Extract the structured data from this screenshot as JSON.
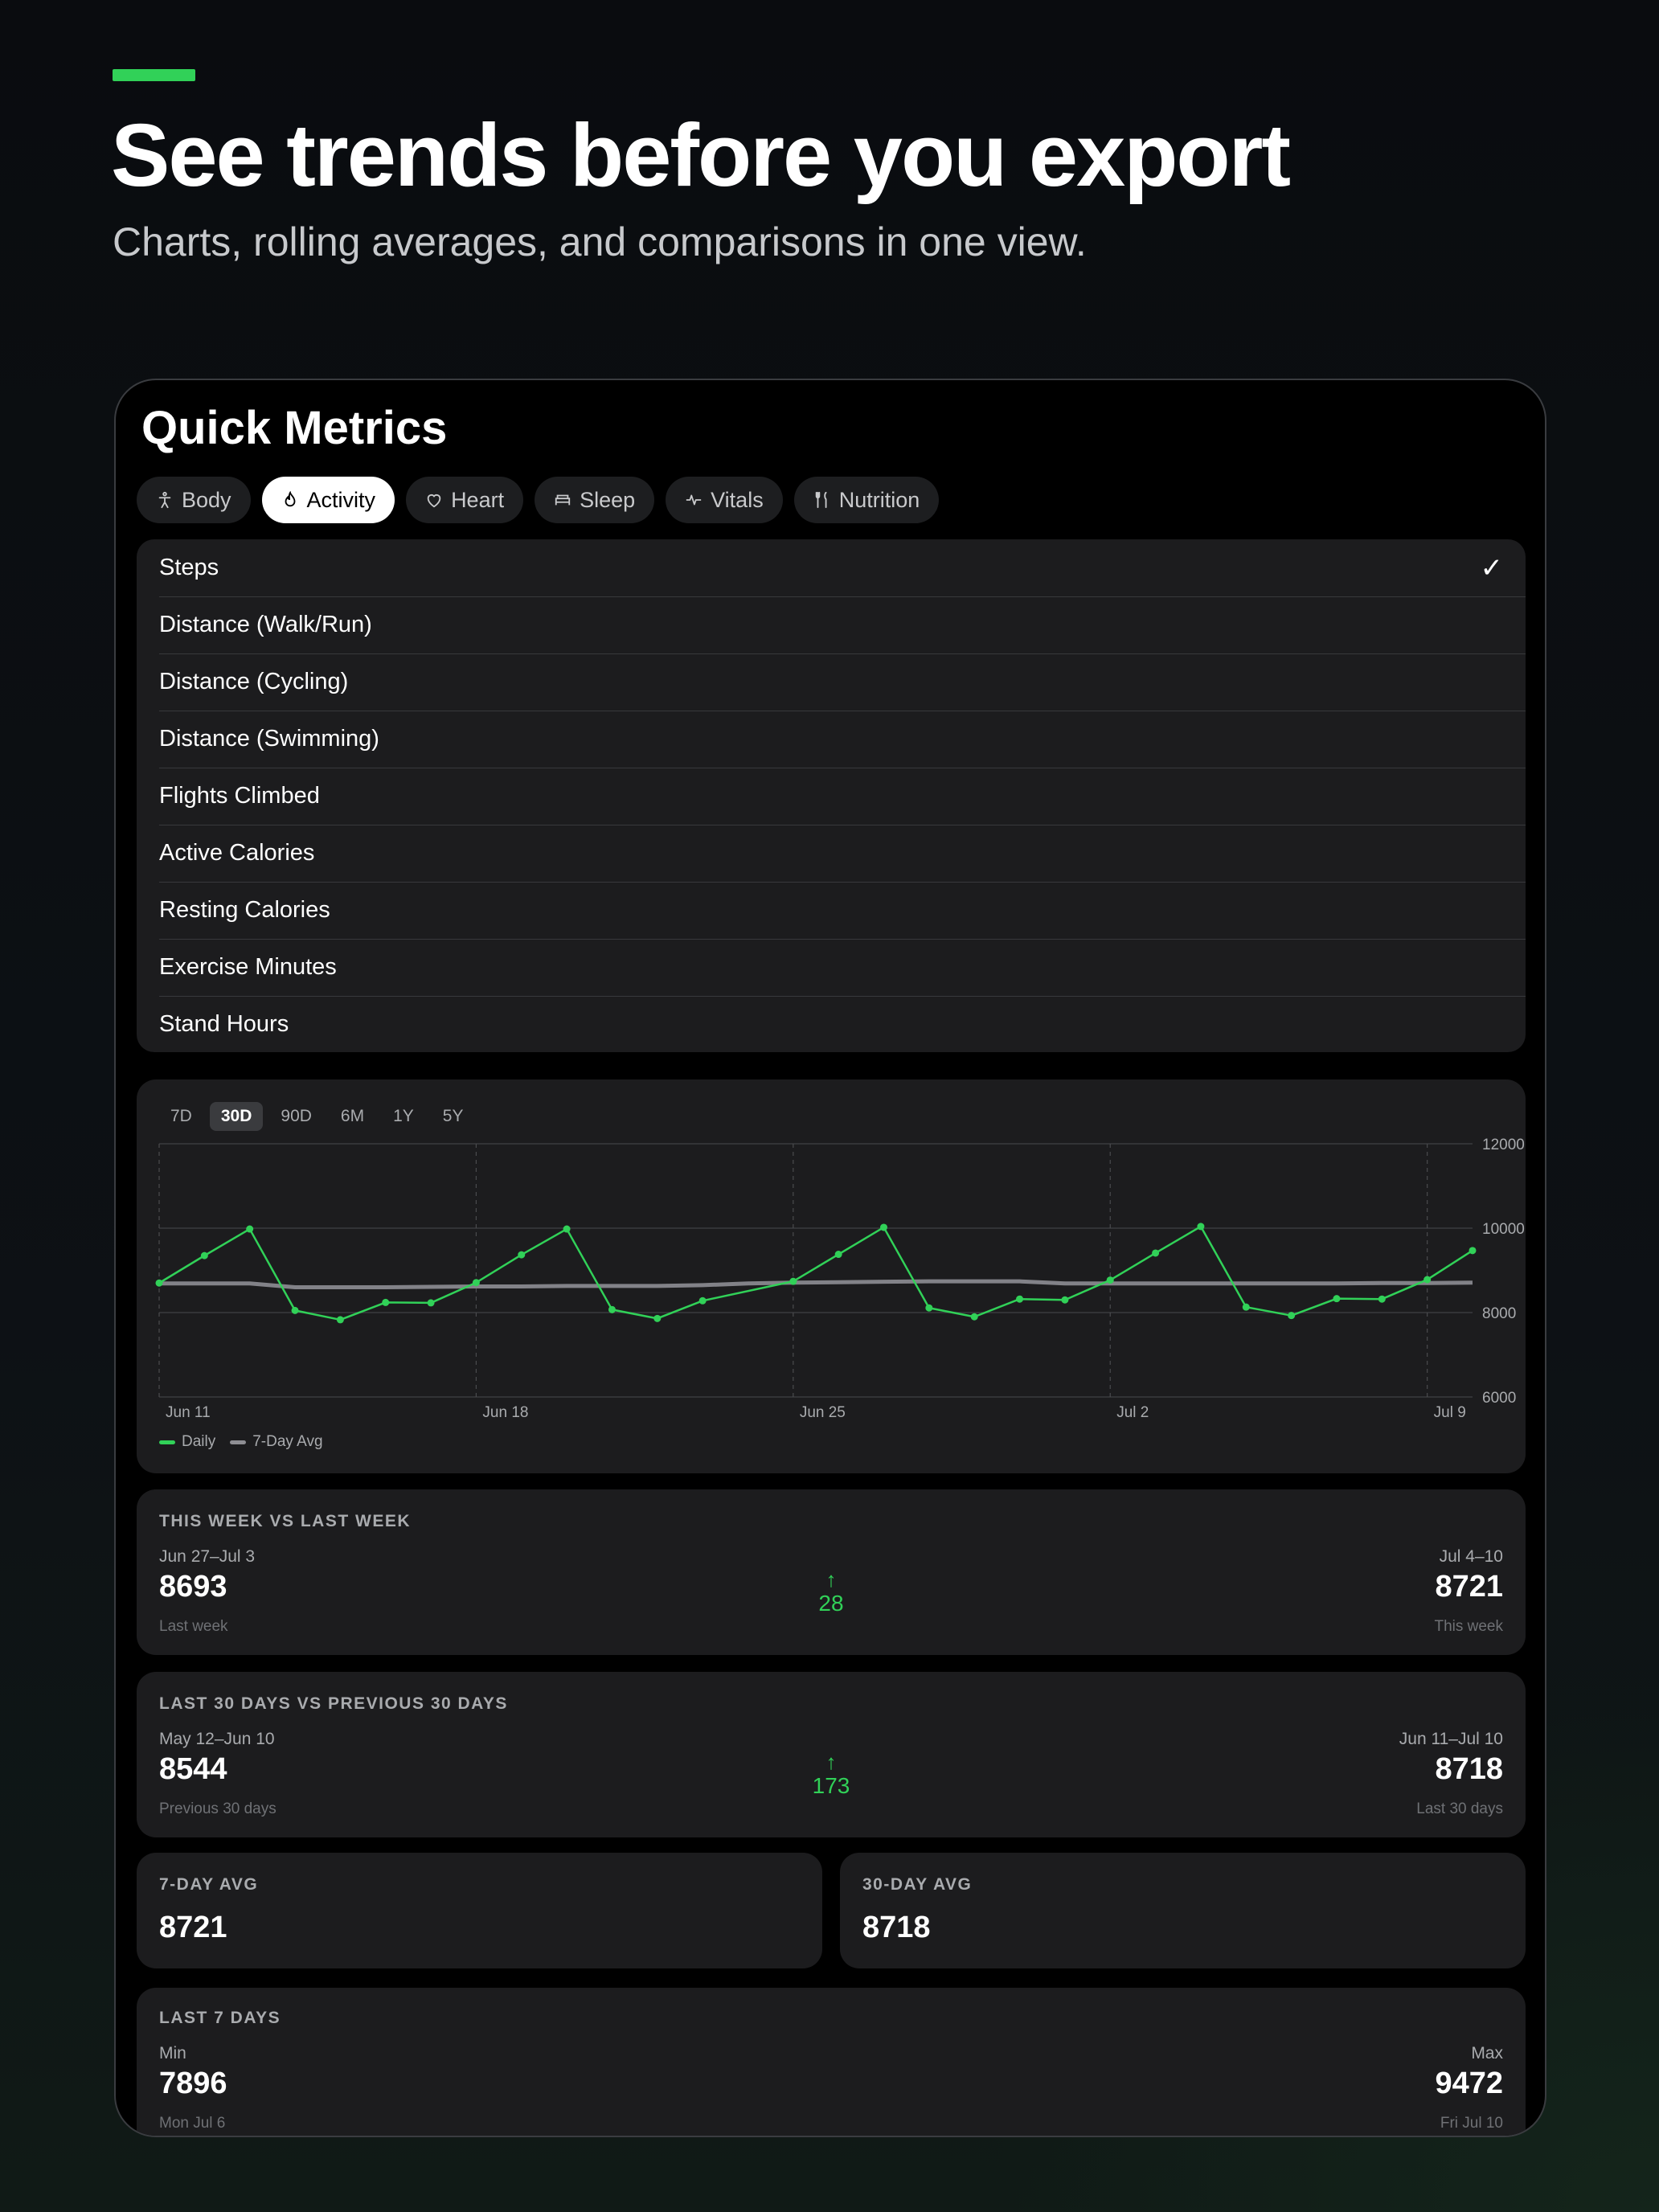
{
  "page": {
    "accent_color": "#31d158",
    "headline": "See trends before you export",
    "subheadline": "Charts, rolling averages, and comparisons in one view."
  },
  "screen": {
    "title": "Quick Metrics",
    "tabs": [
      {
        "label": "Body",
        "icon": "figure-icon",
        "active": false
      },
      {
        "label": "Activity",
        "icon": "flame-icon",
        "active": true
      },
      {
        "label": "Heart",
        "icon": "heart-icon",
        "active": false
      },
      {
        "label": "Sleep",
        "icon": "bed-icon",
        "active": false
      },
      {
        "label": "Vitals",
        "icon": "waveform-icon",
        "active": false
      },
      {
        "label": "Nutrition",
        "icon": "fork-knife-icon",
        "active": false
      }
    ],
    "metrics": [
      {
        "label": "Steps",
        "selected": true
      },
      {
        "label": "Distance (Walk/Run)"
      },
      {
        "label": "Distance (Cycling)"
      },
      {
        "label": "Distance (Swimming)"
      },
      {
        "label": "Flights Climbed"
      },
      {
        "label": "Active Calories"
      },
      {
        "label": "Resting Calories"
      },
      {
        "label": "Exercise Minutes"
      },
      {
        "label": "Stand Hours"
      }
    ],
    "check_glyph": "✓"
  },
  "chart_data": {
    "type": "line",
    "ranges": [
      "7D",
      "30D",
      "90D",
      "6M",
      "1Y",
      "5Y"
    ],
    "active_range": "30D",
    "x_tick_labels": [
      "Jun 11",
      "Jun 18",
      "Jun 25",
      "Jul 2",
      "Jul 9"
    ],
    "y_tick_labels": [
      "12000",
      "10000",
      "8000",
      "6000"
    ],
    "ylim": [
      6000,
      12000
    ],
    "x": [
      "Jun 11",
      "Jun 12",
      "Jun 13",
      "Jun 14",
      "Jun 15",
      "Jun 16",
      "Jun 17",
      "Jun 18",
      "Jun 19",
      "Jun 20",
      "Jun 21",
      "Jun 22",
      "Jun 23",
      "Jun 24",
      "Jun 25",
      "Jun 26",
      "Jun 27",
      "Jun 28",
      "Jun 29",
      "Jun 30",
      "Jul 1",
      "Jul 2",
      "Jul 3",
      "Jul 4",
      "Jul 5",
      "Jul 6",
      "Jul 7",
      "Jul 8",
      "Jul 9",
      "Jul 10"
    ],
    "series": [
      {
        "name": "Daily",
        "color": "#31d158",
        "values": [
          8700,
          9350,
          9980,
          8050,
          7830,
          8240,
          8230,
          8710,
          9370,
          9980,
          8070,
          7860,
          8280,
          null,
          8740,
          9380,
          10020,
          8110,
          7900,
          8320,
          8300,
          8770,
          9410,
          10040,
          8130,
          7930,
          8330,
          8320,
          8780,
          9470
        ]
      },
      {
        "name": "7-Day Avg",
        "color": "#8e8e93",
        "values": [
          8690,
          8690,
          8690,
          8600,
          8600,
          8600,
          8610,
          8620,
          8620,
          8630,
          8630,
          8630,
          8650,
          8690,
          8710,
          8720,
          8730,
          8740,
          8740,
          8740,
          8690,
          8690,
          8690,
          8690,
          8690,
          8690,
          8690,
          8700,
          8700,
          8710
        ]
      }
    ]
  },
  "comparisons": {
    "week": {
      "title": "THIS WEEK VS LAST WEEK",
      "left_range": "Jun 27–Jul 3",
      "left_value": "8693",
      "left_caption": "Last week",
      "delta": "28",
      "delta_arrow": "↑",
      "right_range": "Jul 4–10",
      "right_value": "8721",
      "right_caption": "This week"
    },
    "month": {
      "title": "LAST 30 DAYS VS PREVIOUS 30 DAYS",
      "left_range": "May 12–Jun 10",
      "left_value": "8544",
      "left_caption": "Previous 30 days",
      "delta": "173",
      "delta_arrow": "↑",
      "right_range": "Jun 11–Jul 10",
      "right_value": "8718",
      "right_caption": "Last 30 days"
    }
  },
  "averages": {
    "seven_day": {
      "title": "7-DAY AVG",
      "value": "8721"
    },
    "thirty_day": {
      "title": "30-DAY AVG",
      "value": "8718"
    }
  },
  "last7": {
    "title": "LAST 7 DAYS",
    "min_label": "Min",
    "min_value": "7896",
    "min_date": "Mon Jul 6",
    "max_label": "Max",
    "max_value": "9472",
    "max_date": "Fri Jul 10"
  }
}
